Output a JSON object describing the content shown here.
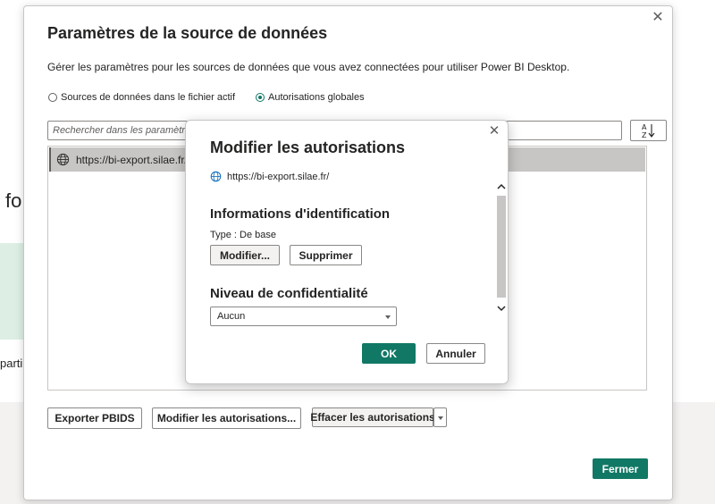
{
  "background": {
    "partial_text_1": "fo",
    "partial_text_2": "parti"
  },
  "main_dialog": {
    "title": "Paramètres de la source de données",
    "description": "Gérer les paramètres pour les sources de données que vous avez connectées pour utiliser Power BI Desktop.",
    "radio_options": [
      {
        "label": "Sources de données dans le fichier actif",
        "selected": false
      },
      {
        "label": "Autorisations globales",
        "selected": true
      }
    ],
    "search_placeholder": "Rechercher dans les paramètres de la source de données",
    "sources": [
      "https://bi-export.silae.fr/"
    ],
    "buttons": {
      "export": "Exporter PBIDS",
      "edit": "Modifier les autorisations...",
      "clear": "Effacer les autorisations",
      "close": "Fermer"
    },
    "close_icon": "close-icon",
    "sort_icon": "sort-az-icon"
  },
  "modal": {
    "title": "Modifier les autorisations",
    "url": "https://bi-export.silae.fr/",
    "credentials_heading": "Informations d'identification",
    "type_text": "Type : De base",
    "edit_button": "Modifier...",
    "delete_button": "Supprimer",
    "privacy_heading": "Niveau de confidentialité",
    "privacy_value": "Aucun",
    "ok_button": "OK",
    "cancel_button": "Annuler"
  },
  "colors": {
    "accent": "#117865",
    "selected_row": "#c8c6c4",
    "text": "#252423"
  }
}
